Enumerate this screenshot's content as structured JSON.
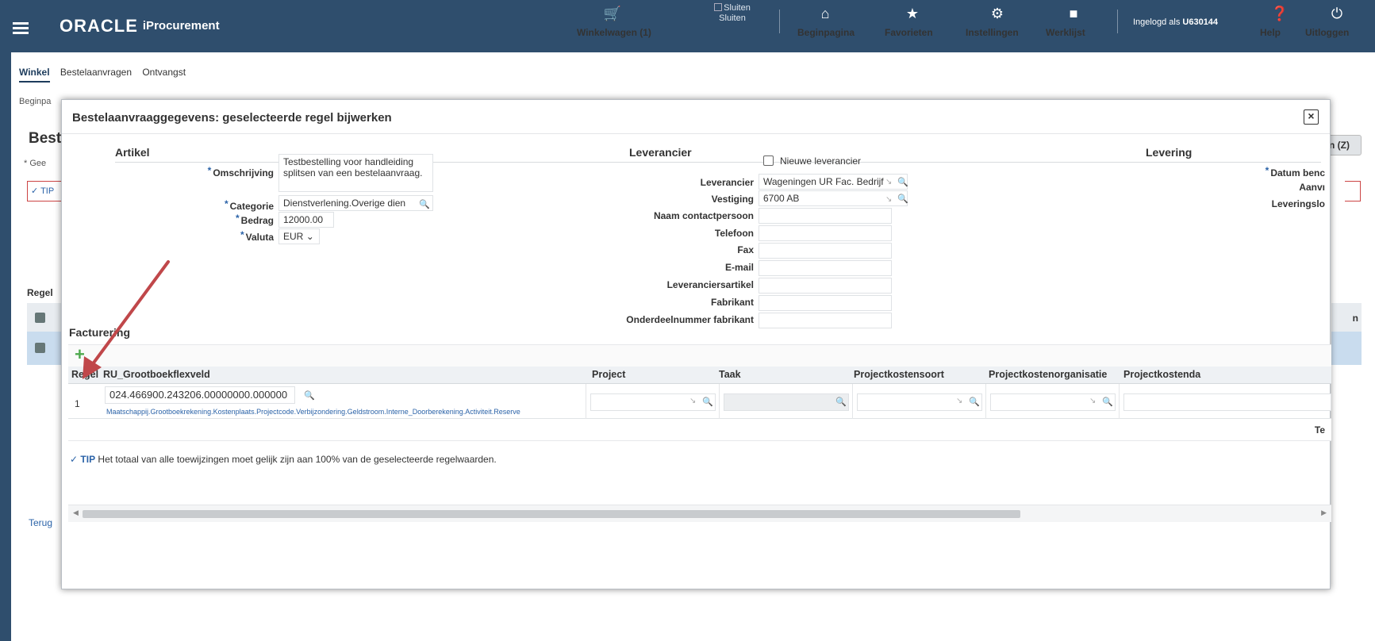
{
  "header": {
    "brand": "ORACLE",
    "product": "iProcurement",
    "cart_label": "Winkelwagen (1)",
    "sluiten_img_label": "Sluiten",
    "sluiten_label": "Sluiten",
    "home_label": "Beginpagina",
    "favorites_label": "Favorieten",
    "settings_label": "Instellingen",
    "worklist_label": "Werklijst",
    "logged_in_prefix": "Ingelogd als",
    "username": "U630144",
    "help_label": "Help",
    "logout_label": "Uitloggen"
  },
  "background": {
    "tabs": [
      "Winkel",
      "Bestelaanvragen",
      "Ontvangst"
    ],
    "breadcrumb": "Beginpa",
    "title": "Best",
    "req_note": "* Gee",
    "tip_label": "TIP",
    "table_label": "Regel",
    "button_z": "n (Z)",
    "right_header": "n",
    "back_link": "Terug"
  },
  "modal": {
    "title": "Bestelaanvraaggegevens: geselecteerde regel bijwerken",
    "close_icon": "close-icon",
    "sections": {
      "artikel": "Artikel",
      "leverancier": "Leverancier",
      "levering": "Levering",
      "facturering": "Facturering"
    },
    "artikel": {
      "omschrijving_label": "Omschrijving",
      "omschrijving_value": "Testbestelling voor handleiding splitsen van een bestelaanvraag.",
      "categorie_label": "Categorie",
      "categorie_value": "Dienstverlening.Overige dien",
      "bedrag_label": "Bedrag",
      "bedrag_value": "12000.00",
      "valuta_label": "Valuta",
      "valuta_value": "EUR"
    },
    "leverancier": {
      "nieuwe_label": "Nieuwe leverancier",
      "leverancier_label": "Leverancier",
      "leverancier_value": "Wageningen UR Fac. Bedrijf",
      "vestiging_label": "Vestiging",
      "vestiging_value": "6700 AB",
      "contact_label": "Naam contactpersoon",
      "telefoon_label": "Telefoon",
      "fax_label": "Fax",
      "email_label": "E-mail",
      "artikel_label": "Leveranciersartikel",
      "fabrikant_label": "Fabrikant",
      "onderdeel_label": "Onderdeelnummer fabrikant"
    },
    "levering": {
      "datum_label": "Datum benc",
      "aanvr_label": "Aanvı",
      "locatie_label": "Leveringslo"
    },
    "table": {
      "headers": [
        "Regel",
        "RU_Grootboekflexveld",
        "Project",
        "Taak",
        "Projectkostensoort",
        "Projectkostenorganisatie",
        "Projectkostenda"
      ],
      "rows": [
        {
          "regel": "1",
          "account": "024.466900.243206.00000000.000000",
          "segments": "Maatschappij.Grootboekrekening.Kostenplaats.Projectcode.Verbijzondering.Geldstroom.Interne_Doorberekening.Activiteit.Reserve"
        }
      ],
      "footer_text": "Te"
    },
    "tip_label": "TIP",
    "tip_text": "Het totaal van alle toewijzingen moet gelijk zijn aan 100% van de geselecteerde regelwaarden."
  },
  "colors": {
    "header_bg": "#2f4e6d",
    "link_blue": "#2b63a8",
    "add_green": "#4ea94e",
    "annotation_arrow": "#c0474a"
  }
}
